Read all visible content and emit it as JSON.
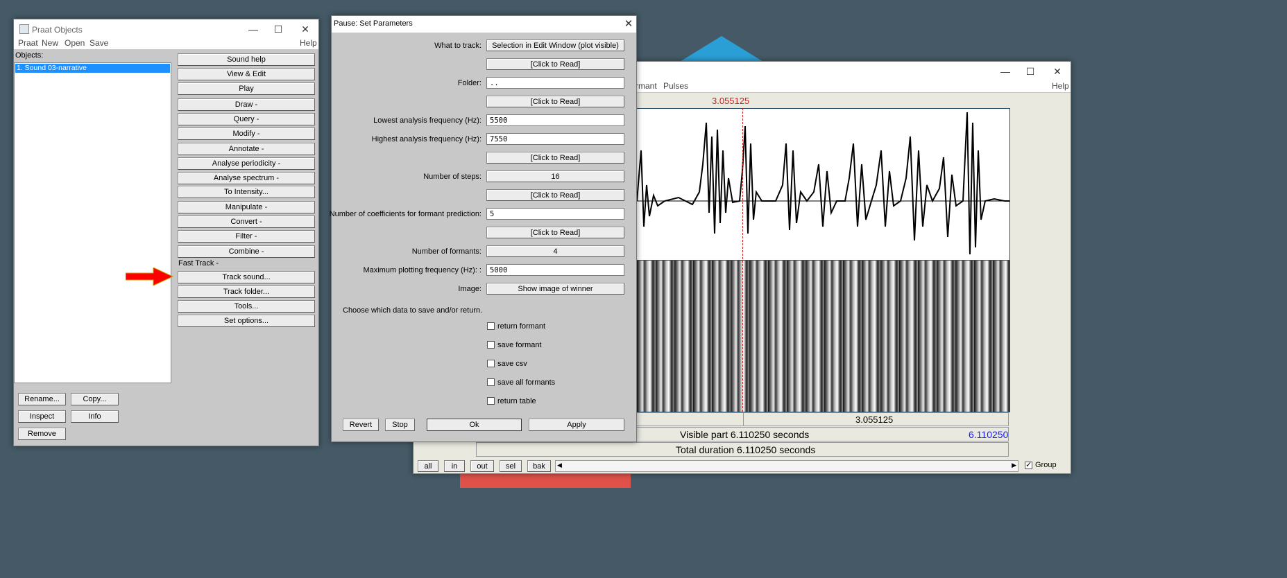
{
  "praat_objects": {
    "title": "Praat Objects",
    "menus": [
      "Praat",
      "New",
      "Open",
      "Save"
    ],
    "help": "Help",
    "objects_label": "Objects:",
    "list_items": [
      "1. Sound 03-narrative"
    ],
    "actions": [
      "Sound help",
      "View & Edit",
      "Play",
      "Draw -",
      "Query -",
      "Modify -",
      "Annotate -",
      "Analyse periodicity -",
      "Analyse spectrum -",
      "To Intensity...",
      "Manipulate -",
      "Convert -",
      "Filter -",
      "Combine -"
    ],
    "fast_track_label": "Fast Track -",
    "fast_track_actions": [
      "Track sound...",
      "Track folder...",
      "Tools...",
      "Set options..."
    ],
    "bottom_buttons": {
      "rename": "Rename...",
      "copy": "Copy...",
      "inspect": "Inspect",
      "info": "Info",
      "remove": "Remove"
    }
  },
  "dialog": {
    "title": "Pause: Set Parameters",
    "close": "✕",
    "what_to_track_label": "What to track:",
    "what_to_track_value": "Selection in Edit Window (plot visible)",
    "click_to_read": "[Click to Read]",
    "folder_label": "Folder:",
    "folder_value": "..",
    "lowest_label": "Lowest analysis frequency (Hz):",
    "lowest_value": "5500",
    "highest_label": "Highest analysis frequency (Hz):",
    "highest_value": "7550",
    "steps_label": "Number of steps:",
    "steps_value": "16",
    "coeffs_label": "Number of coefficients for formant prediction:",
    "coeffs_value": "5",
    "formants_label": "Number of formants:",
    "formants_value": "4",
    "maxplot_label": "Maximum plotting frequency (Hz): :",
    "maxplot_value": "5000",
    "image_label": "Image:",
    "image_value": "Show image of winner",
    "choose_text": "Choose which data to save and/or return.",
    "checkboxes": [
      "return formant",
      "save formant",
      "save csv",
      "save all formants",
      "return table"
    ],
    "buttons": {
      "revert": "Revert",
      "stop": "Stop",
      "ok": "Ok",
      "apply": "Apply"
    }
  },
  "editor": {
    "menus": [
      "rmant",
      "Pulses"
    ],
    "help": "Help",
    "cursor_time": "3.055125",
    "time_row_value": "3.055125",
    "visible_part": "Visible part 6.110250 seconds",
    "visible_end": "6.110250",
    "total_duration": "Total duration 6.110250 seconds",
    "nav_buttons": [
      "all",
      "in",
      "out",
      "sel",
      "bak"
    ],
    "group_label": "Group",
    "group_checked": true
  },
  "colors": {
    "desktop": "#455a66",
    "arrow": "#ff0000",
    "cursor_red": "#cc2222",
    "visible_end_blue": "#1a1aff"
  }
}
